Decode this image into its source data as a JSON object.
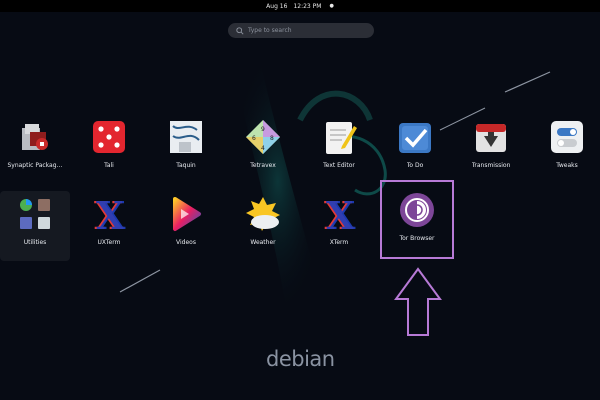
{
  "topbar": {
    "date": "Aug 16",
    "time": "12:23 PM",
    "indicator": "●"
  },
  "search": {
    "placeholder": "Type to search",
    "icon": "search-icon"
  },
  "apps": [
    {
      "label": "Synaptic Packag…",
      "icon": "synaptic-icon"
    },
    {
      "label": "Tali",
      "icon": "dice-icon"
    },
    {
      "label": "Taquin",
      "icon": "taquin-icon"
    },
    {
      "label": "Tetravex",
      "icon": "tetravex-icon"
    },
    {
      "label": "Text Editor",
      "icon": "text-editor-icon"
    },
    {
      "label": "To Do",
      "icon": "todo-icon"
    },
    {
      "label": "Transmission",
      "icon": "transmission-icon"
    },
    {
      "label": "Tweaks",
      "icon": "tweaks-icon"
    },
    {
      "label": "Utilities",
      "icon": "utilities-folder-icon"
    },
    {
      "label": "UXTerm",
      "icon": "x-terminal-icon"
    },
    {
      "label": "Videos",
      "icon": "videos-icon"
    },
    {
      "label": "Weather",
      "icon": "weather-icon"
    },
    {
      "label": "XTerm",
      "icon": "x-terminal-icon"
    },
    {
      "label": "Tor Browser",
      "icon": "tor-browser-icon"
    }
  ],
  "annotation": {
    "highlight_color": "#b77ad6",
    "target": "Tor Browser"
  },
  "branding": {
    "logo_text": "debian"
  },
  "colors": {
    "background": "#070b14",
    "accent_teal": "#0f4a44"
  }
}
